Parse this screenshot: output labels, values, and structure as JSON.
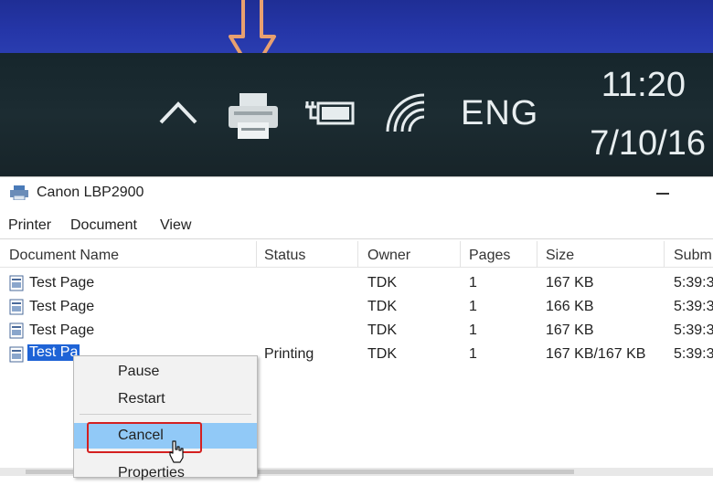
{
  "taskbar": {
    "language": "ENG",
    "time": "11:20",
    "date": "7/10/16",
    "icons": [
      "chevron-up-icon",
      "printer-icon",
      "power-battery-icon",
      "wifi-icon"
    ],
    "arrow_color": "#e8a070"
  },
  "window": {
    "title": "Canon LBP2900",
    "menu": [
      "Printer",
      "Document",
      "View"
    ],
    "columns": [
      "Document Name",
      "Status",
      "Owner",
      "Pages",
      "Size",
      "Subm"
    ],
    "rows": [
      {
        "name": "Test Page",
        "status": "",
        "owner": "TDK",
        "pages": "1",
        "size": "167 KB",
        "submitted": "5:39:3"
      },
      {
        "name": "Test Page",
        "status": "",
        "owner": "TDK",
        "pages": "1",
        "size": "166 KB",
        "submitted": "5:39:3"
      },
      {
        "name": "Test Page",
        "status": "",
        "owner": "TDK",
        "pages": "1",
        "size": "167 KB",
        "submitted": "5:39:3"
      },
      {
        "name": "Test Pa",
        "status": "Printing",
        "owner": "TDK",
        "pages": "1",
        "size": "167 KB/167 KB",
        "submitted": "5:39:3"
      }
    ]
  },
  "context_menu": {
    "items": [
      "Pause",
      "Restart",
      "Cancel",
      "Properties"
    ],
    "highlighted": "Cancel",
    "highlight_color": "#91c9f7",
    "callout_color": "#d42020"
  }
}
